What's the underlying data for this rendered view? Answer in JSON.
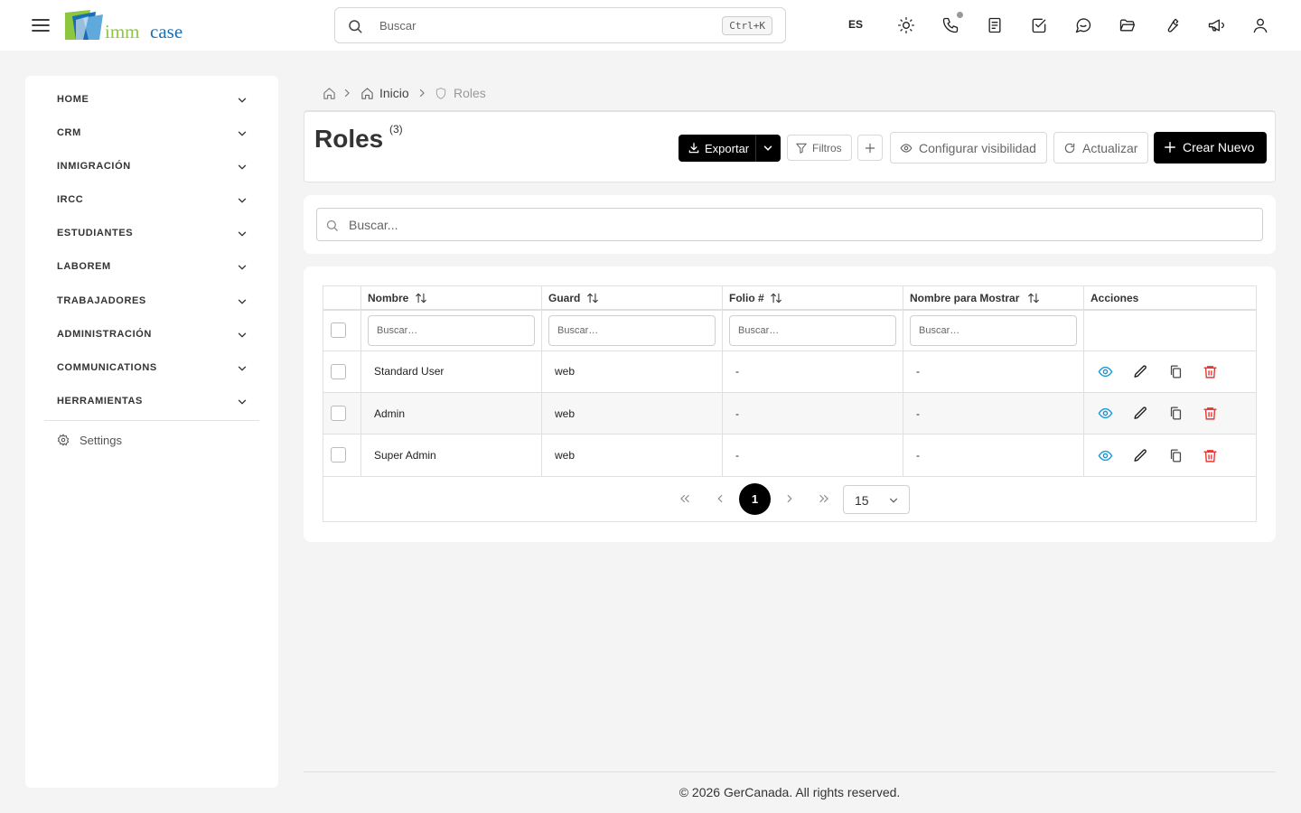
{
  "topbar": {
    "logo": {
      "part1": "imm",
      "part2": "case"
    },
    "search_placeholder": "Buscar",
    "search_shortcut": "Ctrl+K",
    "language": "ES",
    "icons": [
      "sun-icon",
      "phone-icon",
      "notes-icon",
      "tasks-icon",
      "chat-icon",
      "folder-icon",
      "tools-icon",
      "megaphone-icon",
      "user-icon"
    ]
  },
  "sidebar": {
    "items": [
      {
        "label": "HOME"
      },
      {
        "label": "CRM"
      },
      {
        "label": "INMIGRACIÓN"
      },
      {
        "label": "IRCC"
      },
      {
        "label": "ESTUDIANTES"
      },
      {
        "label": "LABOREM"
      },
      {
        "label": "TRABAJADORES"
      },
      {
        "label": "ADMINISTRACIÓN"
      },
      {
        "label": "COMMUNICATIONS"
      },
      {
        "label": "HERRAMIENTAS"
      }
    ],
    "settings_label": "Settings"
  },
  "breadcrumb": {
    "inicio": "Inicio",
    "current": "Roles"
  },
  "header": {
    "title": "Roles",
    "count": "(3)",
    "export_label": "Exportar",
    "filters_label": "Filtros",
    "visibility_label": "Configurar visibilidad",
    "refresh_label": "Actualizar",
    "create_label": "Crear Nuevo"
  },
  "global_search": {
    "placeholder": "Buscar..."
  },
  "table": {
    "columns": [
      "Nombre",
      "Guard",
      "Folio #",
      "Nombre para Mostrar",
      "Acciones"
    ],
    "filter_placeholder": "Buscar…",
    "rows": [
      {
        "nombre": "Standard User",
        "guard": "web",
        "folio": "-",
        "mostrar": "-"
      },
      {
        "nombre": "Admin",
        "guard": "web",
        "folio": "-",
        "mostrar": "-"
      },
      {
        "nombre": "Super Admin",
        "guard": "web",
        "folio": "-",
        "mostrar": "-"
      }
    ],
    "actions": [
      "view-icon",
      "edit-icon",
      "copy-icon",
      "delete-icon"
    ],
    "colors": {
      "view": "#1a9bd7",
      "delete": "#e53935"
    }
  },
  "pagination": {
    "current_page": "1",
    "per_page": "15"
  },
  "footer": {
    "text": "© 2026 GerCanada. All rights reserved."
  }
}
